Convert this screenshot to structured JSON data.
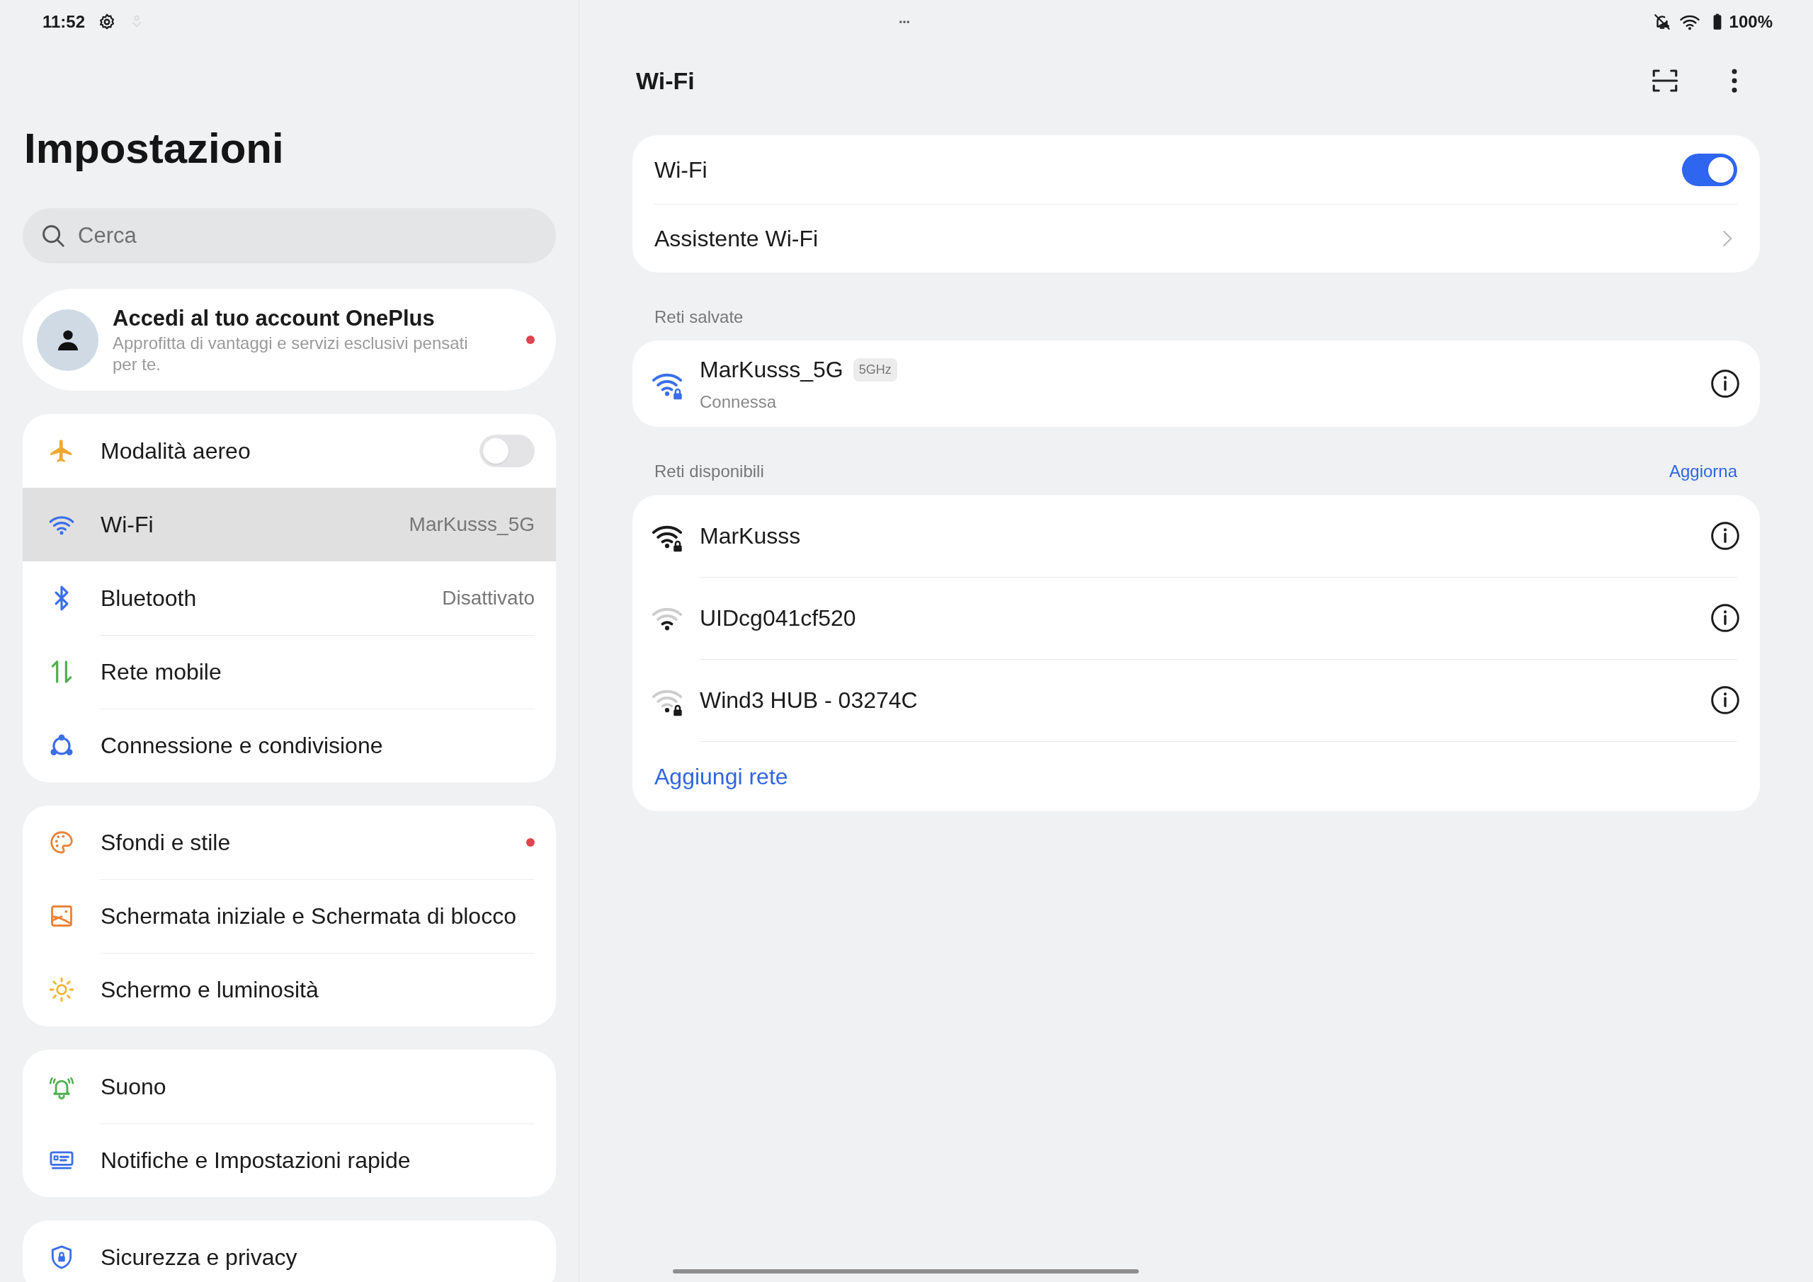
{
  "status_bar": {
    "time": "11:52",
    "battery": "100%"
  },
  "sidebar": {
    "title": "Impostazioni",
    "search": {
      "placeholder": "Cerca"
    },
    "account": {
      "title": "Accedi al tuo account OnePlus",
      "subtitle": "Approfitta di vantaggi e servizi esclusivi pensati per te.",
      "badge": true
    },
    "groups": [
      {
        "items": [
          {
            "label": "Modalità aereo",
            "kind": "toggle",
            "on": false,
            "selected": false,
            "badge": false
          },
          {
            "label": "Wi-Fi",
            "kind": "value",
            "value": "MarKusss_5G",
            "selected": true,
            "badge": false
          },
          {
            "label": "Bluetooth",
            "kind": "value",
            "value": "Disattivato",
            "selected": false,
            "badge": false
          },
          {
            "label": "Rete mobile",
            "kind": "link",
            "selected": false,
            "badge": false
          },
          {
            "label": "Connessione e condivisione",
            "kind": "link",
            "selected": false,
            "badge": false
          }
        ]
      },
      {
        "items": [
          {
            "label": "Sfondi e stile",
            "kind": "link",
            "selected": false,
            "badge": true
          },
          {
            "label": "Schermata iniziale e Schermata di blocco",
            "kind": "link",
            "selected": false,
            "badge": false
          },
          {
            "label": "Schermo e luminosità",
            "kind": "link",
            "selected": false,
            "badge": false
          }
        ]
      },
      {
        "items": [
          {
            "label": "Suono",
            "kind": "link",
            "selected": false,
            "badge": false
          },
          {
            "label": "Notifiche e Impostazioni rapide",
            "kind": "link",
            "selected": false,
            "badge": false
          }
        ]
      },
      {
        "items": [
          {
            "label": "Sicurezza e privacy",
            "kind": "link",
            "selected": false,
            "badge": false
          }
        ]
      }
    ]
  },
  "detail": {
    "title": "Wi-Fi",
    "main_rows": [
      {
        "label": "Wi-Fi",
        "kind": "toggle",
        "on": true
      },
      {
        "label": "Assistente Wi-Fi",
        "kind": "link"
      }
    ],
    "saved_networks": {
      "heading": "Reti salvate",
      "networks": [
        {
          "name": "MarKusss_5G",
          "band": "5GHz",
          "status": "Connessa",
          "connected": true,
          "secured": true
        }
      ]
    },
    "available_networks": {
      "heading": "Reti disponibili",
      "action": "Aggiorna",
      "networks": [
        {
          "name": "MarKusss",
          "secured": true
        },
        {
          "name": "UIDcg041cf520",
          "secured": false
        },
        {
          "name": "Wind3 HUB - 03274C",
          "secured": true
        }
      ],
      "add_label": "Aggiungi rete"
    }
  }
}
